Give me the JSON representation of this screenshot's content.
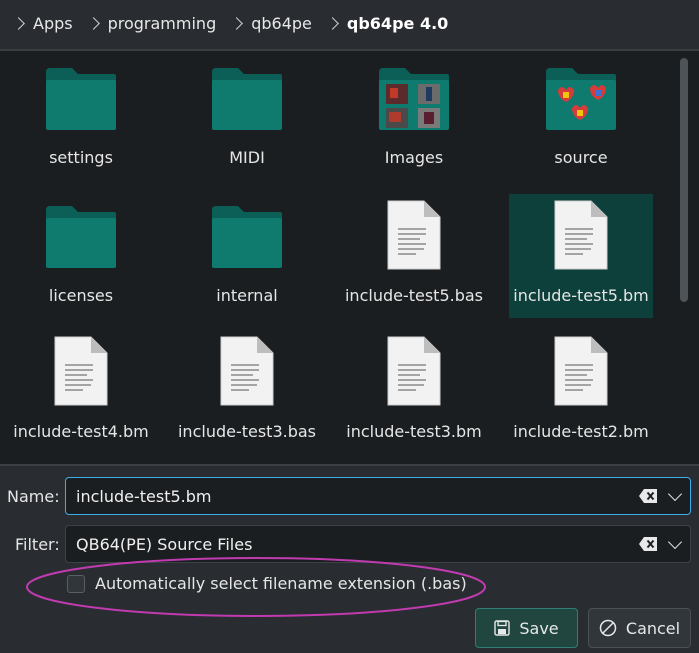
{
  "breadcrumb": {
    "items": [
      "Apps",
      "programming",
      "qb64pe",
      "qb64pe 4.0"
    ]
  },
  "files": [
    {
      "name": "settings",
      "kind": "folder"
    },
    {
      "name": "MIDI",
      "kind": "folder"
    },
    {
      "name": "Images",
      "kind": "folder-images"
    },
    {
      "name": "source",
      "kind": "folder-source"
    },
    {
      "name": "licenses",
      "kind": "folder"
    },
    {
      "name": "internal",
      "kind": "folder"
    },
    {
      "name": "include-test5.bas",
      "kind": "file"
    },
    {
      "name": "include-test5.bm",
      "kind": "file",
      "selected": true
    },
    {
      "name": "include-test4.bm",
      "kind": "file"
    },
    {
      "name": "include-test3.bas",
      "kind": "file"
    },
    {
      "name": "include-test3.bm",
      "kind": "file"
    },
    {
      "name": "include-test2.bm",
      "kind": "file"
    }
  ],
  "name_field": {
    "label": "Name:",
    "value": "include-test5.bm"
  },
  "filter_field": {
    "label": "Filter:",
    "value": "QB64(PE) Source Files"
  },
  "auto_extension": {
    "label": "Automatically select filename extension (.bas)",
    "checked": false
  },
  "buttons": {
    "save": "Save",
    "cancel": "Cancel"
  },
  "colors": {
    "accent": "#3daee9",
    "folder": "#0f7a6e",
    "selection": "#0d3f3b",
    "annotation": "#c13bb0"
  }
}
